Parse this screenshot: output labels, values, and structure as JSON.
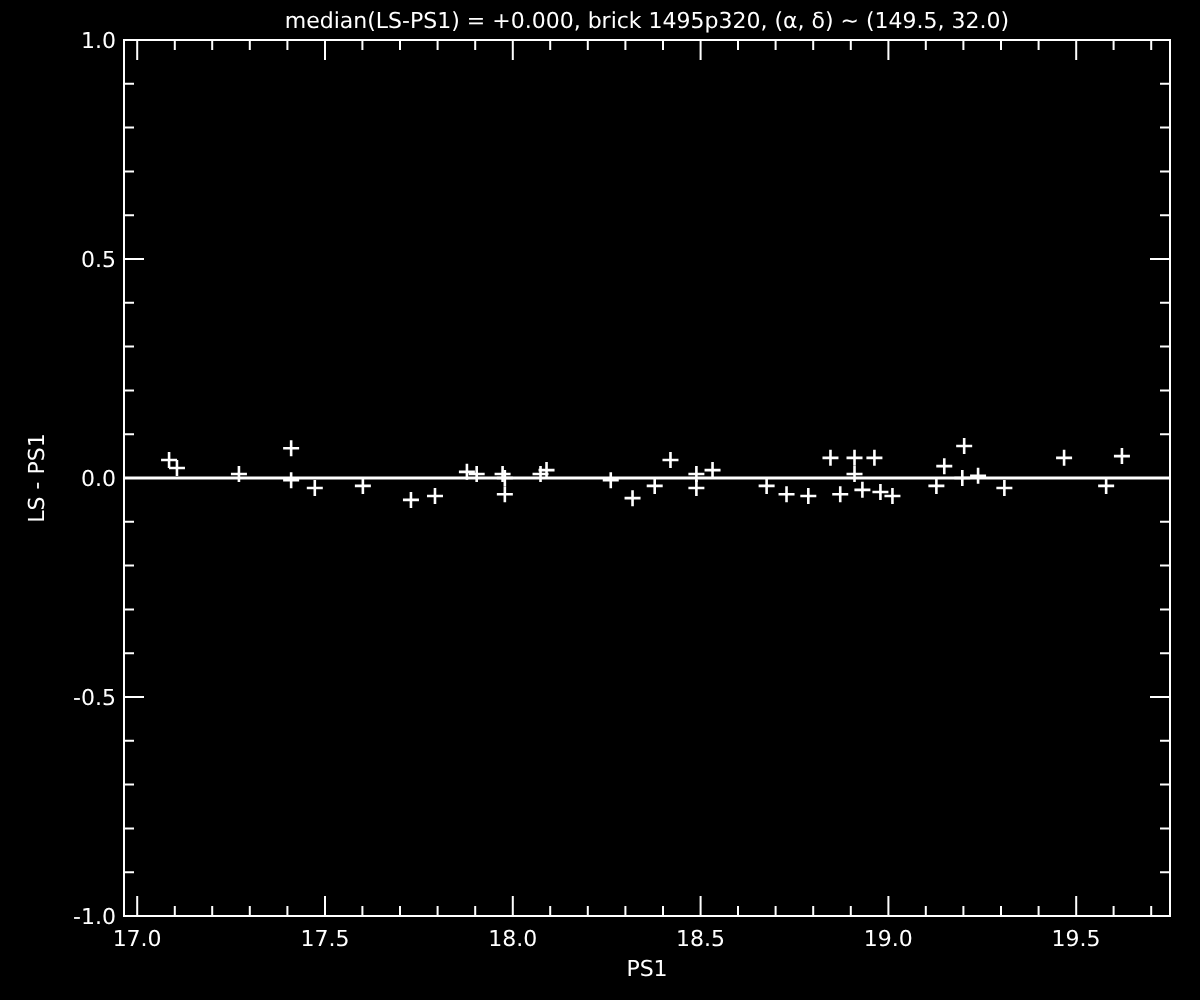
{
  "chart_data": {
    "type": "scatter",
    "title": "median(LS-PS1) = +0.000, brick 1495p320, (α, δ) ~ (149.5, 32.0)",
    "xlabel": "PS1",
    "ylabel": "LS - PS1",
    "xlim": [
      16.965,
      19.75
    ],
    "ylim": [
      -1,
      1
    ],
    "xticks": [
      {
        "value": 17,
        "label": "17.0"
      },
      {
        "value": 17.5,
        "label": "17.5"
      },
      {
        "value": 18,
        "label": "18.0"
      },
      {
        "value": 18.5,
        "label": "18.5"
      },
      {
        "value": 19,
        "label": "19.0"
      },
      {
        "value": 19.5,
        "label": "19.5"
      }
    ],
    "yticks": [
      {
        "value": -1,
        "label": "-1.0"
      },
      {
        "value": -0.5,
        "label": "-0.5"
      },
      {
        "value": 0,
        "label": "0.0"
      },
      {
        "value": 0.5,
        "label": "0.5"
      },
      {
        "value": 1,
        "label": "1.0"
      }
    ],
    "series": [
      {
        "color": "#ffffff",
        "x": [
          17.085,
          17.106,
          17.271,
          17.41,
          17.41,
          17.473,
          17.601,
          17.729,
          17.793,
          17.878,
          17.904,
          17.973,
          17.979,
          17.979,
          18.074,
          18.09,
          18.261,
          18.319,
          18.378,
          18.42,
          18.489,
          18.489,
          18.532,
          18.676,
          18.729,
          18.787,
          18.846,
          18.872,
          18.91,
          18.91,
          18.931,
          18.963,
          18.979,
          19.011,
          19.128,
          19.149,
          19.197,
          19.202,
          19.239,
          19.309,
          19.468,
          19.58,
          19.622
        ],
        "values": [
          0.041,
          0.023,
          0.009,
          0.068,
          -0.005,
          -0.023,
          -0.018,
          -0.05,
          -0.041,
          0.014,
          0.009,
          0.009,
          0,
          -0.037,
          0.009,
          0.018,
          -0.005,
          -0.046,
          -0.018,
          0.041,
          -0.023,
          0.009,
          0.018,
          -0.018,
          -0.037,
          -0.041,
          0.046,
          -0.037,
          0.046,
          0.009,
          -0.027,
          0.046,
          -0.032,
          -0.041,
          -0.018,
          0.027,
          0,
          0.073,
          0.005,
          -0.023,
          0.046,
          -0.018,
          0.05
        ]
      }
    ],
    "ref_lines": [
      {
        "axis": "y",
        "value": 0
      }
    ]
  }
}
